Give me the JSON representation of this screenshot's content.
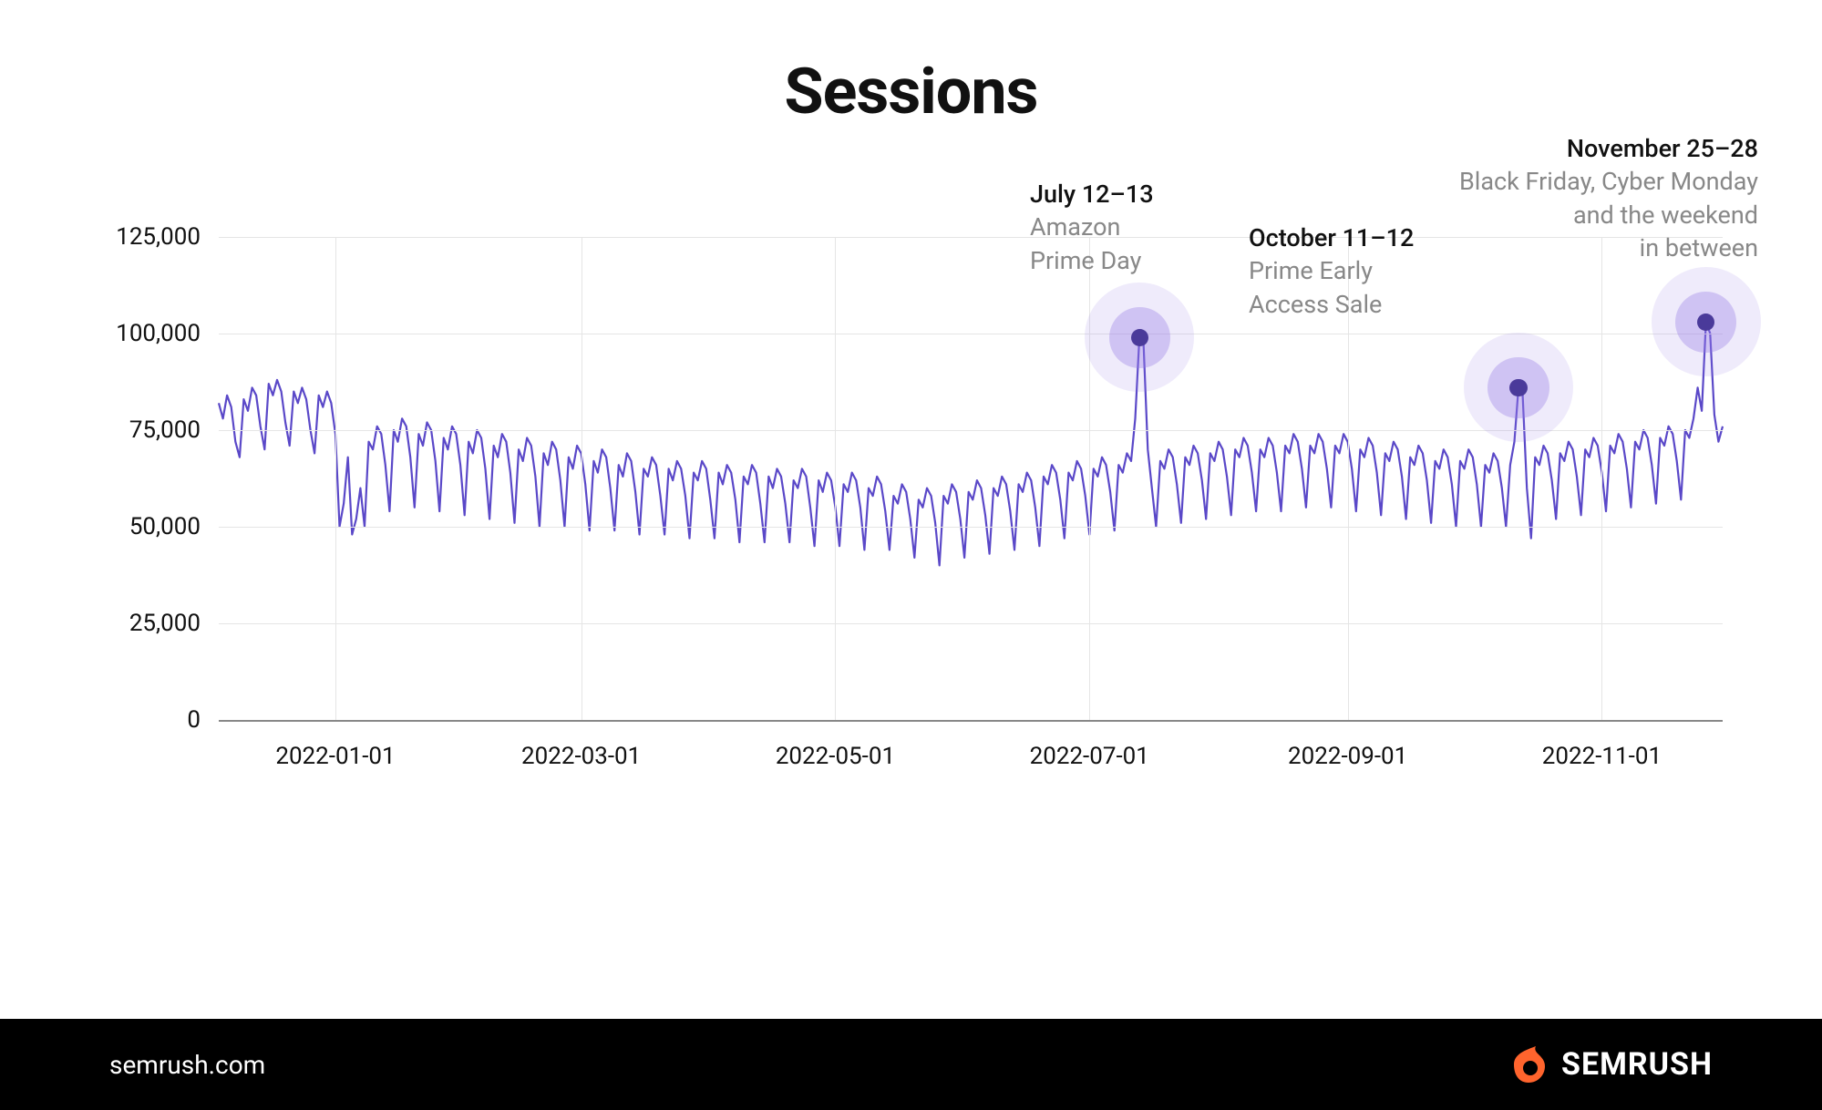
{
  "title": "Sessions",
  "footer": {
    "url": "semrush.com",
    "brand": "SEMRUSH"
  },
  "annotations": [
    {
      "date": "July 12–13",
      "desc": "Amazon\nPrime Day",
      "align": "left"
    },
    {
      "date": "October 11–12",
      "desc": "Prime Early\nAccess Sale",
      "align": "left"
    },
    {
      "date": "November 25–28",
      "desc": "Black Friday, Cyber Monday\nand the weekend\nin between",
      "align": "right"
    }
  ],
  "chart_data": {
    "type": "line",
    "title": "Sessions",
    "xlabel": "",
    "ylabel": "",
    "ylim": [
      0,
      125000
    ],
    "y_ticks": [
      0,
      25000,
      50000,
      75000,
      100000,
      125000
    ],
    "y_tick_labels": [
      "0",
      "25,000",
      "50,000",
      "75,000",
      "100,000",
      "125,000"
    ],
    "x_tick_labels": [
      "2022-01-01",
      "2022-03-01",
      "2022-05-01",
      "2022-07-01",
      "2022-09-01",
      "2022-11-01"
    ],
    "x_tick_indices": [
      28,
      87,
      148,
      209,
      271,
      332
    ],
    "x_start_date": "2021-12-04",
    "x_end_date": "2022-11-30",
    "highlights": [
      {
        "label": "July 12–13",
        "index": 221,
        "value": 99000
      },
      {
        "label": "October 11–12",
        "index": 312,
        "value": 86000
      },
      {
        "label": "November 25–28",
        "index": 357,
        "value": 103000
      }
    ],
    "values": [
      82000,
      78000,
      84000,
      81000,
      72000,
      68000,
      83000,
      80000,
      86000,
      84000,
      76000,
      70000,
      87000,
      84000,
      88000,
      85000,
      77000,
      71000,
      85000,
      82000,
      86000,
      83000,
      75000,
      69000,
      84000,
      81000,
      85000,
      82000,
      74000,
      50000,
      56000,
      68000,
      48000,
      52000,
      60000,
      50000,
      72000,
      70000,
      76000,
      74000,
      66000,
      54000,
      75000,
      72000,
      78000,
      76000,
      68000,
      55000,
      74000,
      71000,
      77000,
      75000,
      67000,
      54000,
      73000,
      70000,
      76000,
      74000,
      66000,
      53000,
      72000,
      69000,
      75000,
      73000,
      65000,
      52000,
      71000,
      68000,
      74000,
      72000,
      64000,
      51000,
      70000,
      67000,
      73000,
      71000,
      63000,
      50000,
      69000,
      66000,
      72000,
      70000,
      62000,
      50000,
      68000,
      65000,
      71000,
      69000,
      61000,
      49000,
      67000,
      64000,
      70000,
      68000,
      60000,
      49000,
      66000,
      63000,
      69000,
      67000,
      59000,
      48000,
      65000,
      63000,
      68000,
      66000,
      58000,
      48000,
      65000,
      62000,
      67000,
      65000,
      58000,
      47000,
      64000,
      62000,
      67000,
      65000,
      57000,
      47000,
      64000,
      61000,
      66000,
      64000,
      57000,
      46000,
      63000,
      61000,
      66000,
      64000,
      56000,
      46000,
      63000,
      60000,
      65000,
      63000,
      56000,
      46000,
      62000,
      60000,
      65000,
      63000,
      55000,
      45000,
      62000,
      59000,
      64000,
      62000,
      55000,
      45000,
      61000,
      59000,
      64000,
      62000,
      55000,
      44000,
      60000,
      58000,
      63000,
      61000,
      54000,
      44000,
      58000,
      56000,
      61000,
      59000,
      52000,
      42000,
      57000,
      55000,
      60000,
      58000,
      51000,
      40000,
      58000,
      56000,
      61000,
      59000,
      52000,
      42000,
      59000,
      57000,
      62000,
      60000,
      53000,
      43000,
      60000,
      58000,
      63000,
      61000,
      54000,
      44000,
      61000,
      59000,
      64000,
      62000,
      55000,
      45000,
      63000,
      61000,
      66000,
      64000,
      57000,
      47000,
      64000,
      62000,
      67000,
      65000,
      58000,
      48000,
      65000,
      63000,
      68000,
      66000,
      59000,
      49000,
      66000,
      64000,
      69000,
      67000,
      78000,
      99000,
      97000,
      70000,
      60000,
      50000,
      67000,
      65000,
      70000,
      68000,
      61000,
      51000,
      68000,
      66000,
      71000,
      69000,
      62000,
      52000,
      69000,
      67000,
      72000,
      70000,
      63000,
      53000,
      70000,
      68000,
      73000,
      71000,
      64000,
      54000,
      70000,
      68000,
      73000,
      71000,
      64000,
      54000,
      71000,
      69000,
      74000,
      72000,
      65000,
      55000,
      71000,
      69000,
      74000,
      72000,
      65000,
      55000,
      71000,
      69000,
      74000,
      72000,
      65000,
      54000,
      70000,
      68000,
      73000,
      71000,
      64000,
      53000,
      69000,
      67000,
      72000,
      70000,
      63000,
      52000,
      68000,
      66000,
      71000,
      69000,
      62000,
      51000,
      67000,
      65000,
      70000,
      68000,
      61000,
      50000,
      67000,
      65000,
      70000,
      68000,
      61000,
      50000,
      66000,
      64000,
      69000,
      67000,
      60000,
      50000,
      66000,
      72000,
      86000,
      84000,
      60000,
      47000,
      68000,
      66000,
      71000,
      69000,
      62000,
      52000,
      69000,
      67000,
      72000,
      70000,
      63000,
      53000,
      70000,
      68000,
      73000,
      71000,
      64000,
      54000,
      71000,
      69000,
      74000,
      72000,
      65000,
      55000,
      72000,
      70000,
      75000,
      73000,
      66000,
      56000,
      73000,
      71000,
      76000,
      74000,
      67000,
      57000,
      75000,
      73000,
      78000,
      86000,
      80000,
      103000,
      100000,
      79000,
      72000,
      76000
    ]
  }
}
